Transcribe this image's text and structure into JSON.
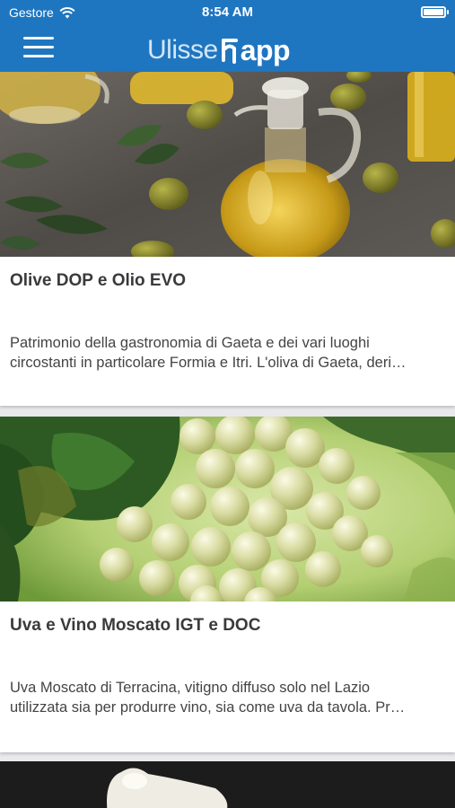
{
  "status_bar": {
    "carrier": "Gestore",
    "time": "8:54 AM"
  },
  "header": {
    "logo_left": "Ulisse",
    "logo_right": "app"
  },
  "cards": [
    {
      "title": "Olive DOP e Olio EVO",
      "description_lines": [
        "Patrimonio della gastronomia di Gaeta e dei vari luoghi",
        "circostanti in particolare Formia e Itri. L'oliva di Gaeta, deri…"
      ]
    },
    {
      "title": "Uva e Vino Moscato IGT e DOC",
      "description_lines": [
        "Uva Moscato di Terracina, vitigno diffuso solo nel Lazio",
        "utilizzata sia per produrre vino, sia come uva da tavola. Pr…"
      ]
    }
  ],
  "colors": {
    "header_blue": "#1f76c0",
    "card_background": "#ffffff",
    "page_background": "#e9e9ec",
    "title_text": "#3a3a3a"
  }
}
